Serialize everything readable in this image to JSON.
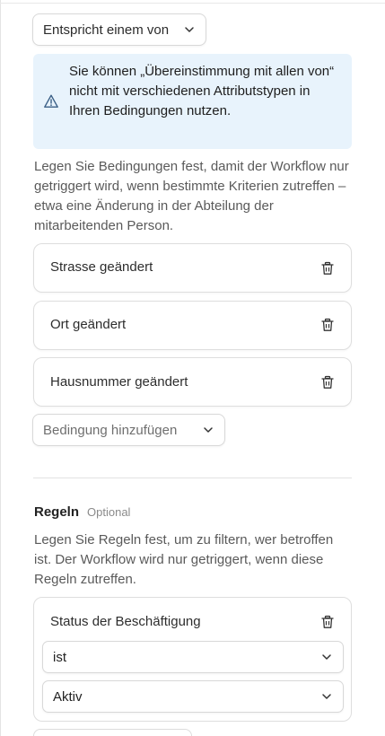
{
  "match_dropdown": {
    "label": "Entspricht einem von"
  },
  "info": {
    "text": "Sie können „Übereinstimmung mit allen von“ nicht mit verschiedenen Attributstypen in Ihren Bedingungen nutzen."
  },
  "conditions": {
    "description": "Legen Sie Bedingungen fest, damit der Workflow nur getriggert wird, wenn bestimmte Kriterien zutreffen – etwa eine Änderung in der Abteilung der mitarbeitenden Person.",
    "items": [
      {
        "label": "Strasse geändert"
      },
      {
        "label": "Ort geändert"
      },
      {
        "label": "Hausnummer geändert"
      }
    ],
    "add_label": "Bedingung hinzufügen"
  },
  "rules": {
    "title": "Regeln",
    "optional": "Optional",
    "description": "Legen Sie Regeln fest, um zu filtern, wer betroffen ist. Der Workflow wird nur getriggert, wenn diese Regeln zutreffen.",
    "card": {
      "title": "Status der Beschäftigung",
      "operator": "ist",
      "value": "Aktiv"
    }
  },
  "icons": {
    "info": "warning-triangle-icon",
    "delete": "trash-icon",
    "chevron": "chevron-down-icon"
  },
  "colors": {
    "info_bg": "#e8f3fc",
    "border": "#dedede",
    "muted_text": "#5a5a5a"
  }
}
